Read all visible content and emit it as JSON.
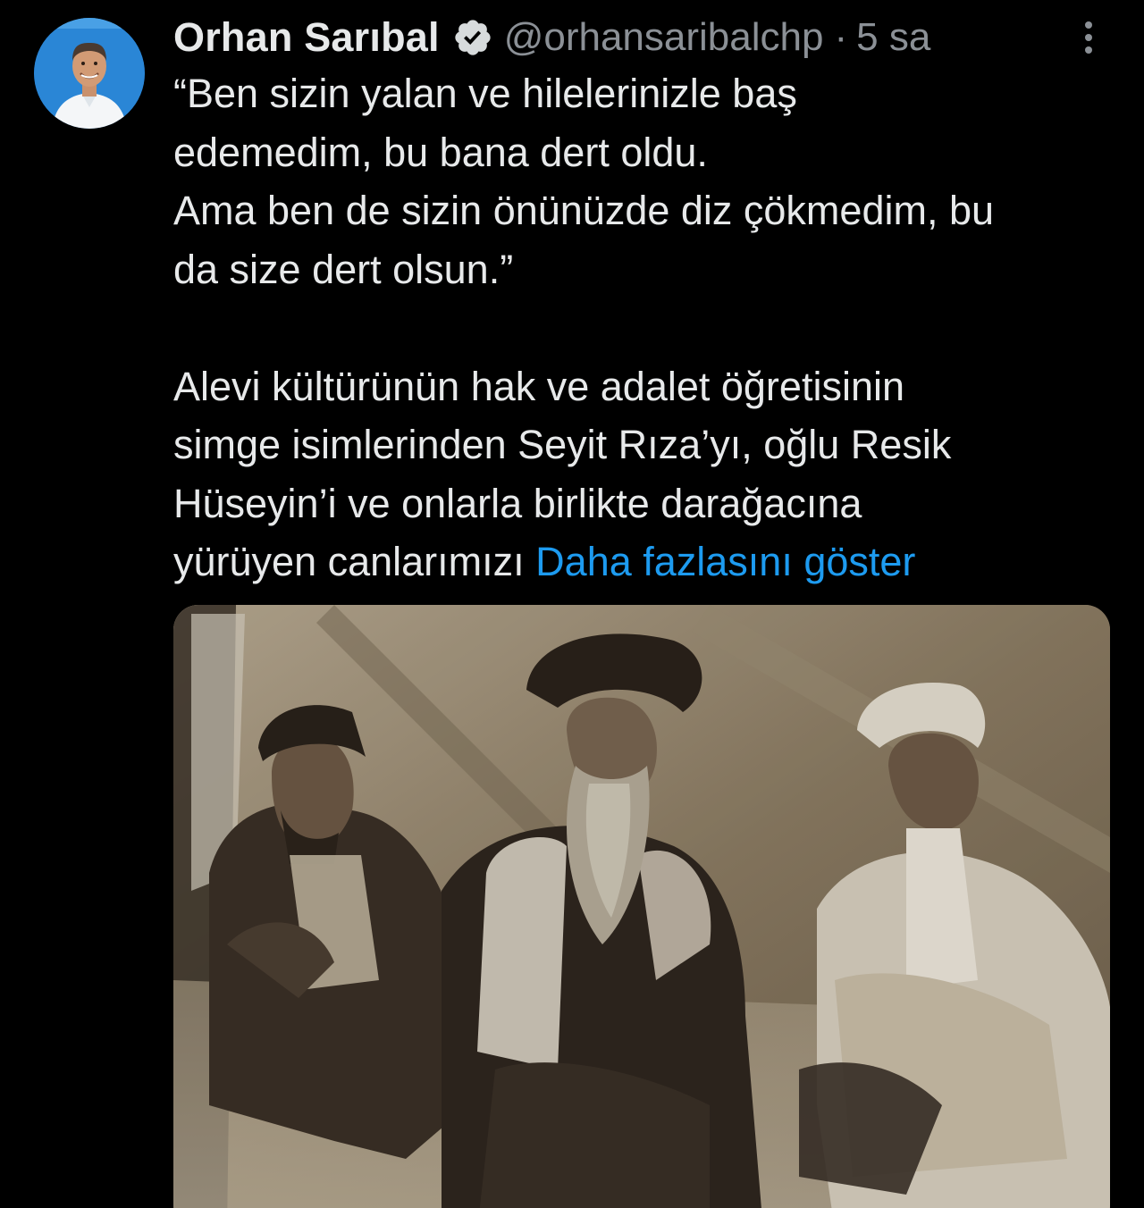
{
  "tweet": {
    "author": {
      "display_name": "Orhan Sarıbal",
      "handle": "@orhansaribalchp",
      "verified_icon": "verified-badge-icon"
    },
    "separator": "·",
    "time": "5 sa",
    "more_icon": "more-vertical-icon",
    "text_lines": [
      "“Ben sizin yalan ve hilelerinizle baş",
      "edemedim, bu bana dert oldu.",
      "Ama ben de sizin önünüzde diz çökmedim, bu",
      "da size dert olsun.”",
      "Alevi kültürünün hak ve adalet öğretisinin",
      "simge isimlerinden Seyit Rıza’yı, oğlu Resik",
      "Hüseyin’i ve onlarla birlikte darağacına",
      "yürüyen canlarımızı"
    ],
    "show_more": "Daha fazlasını göster",
    "colors": {
      "background": "#000000",
      "text": "#e7e9ea",
      "secondary": "#8b9096",
      "link": "#1d9bf0"
    }
  }
}
